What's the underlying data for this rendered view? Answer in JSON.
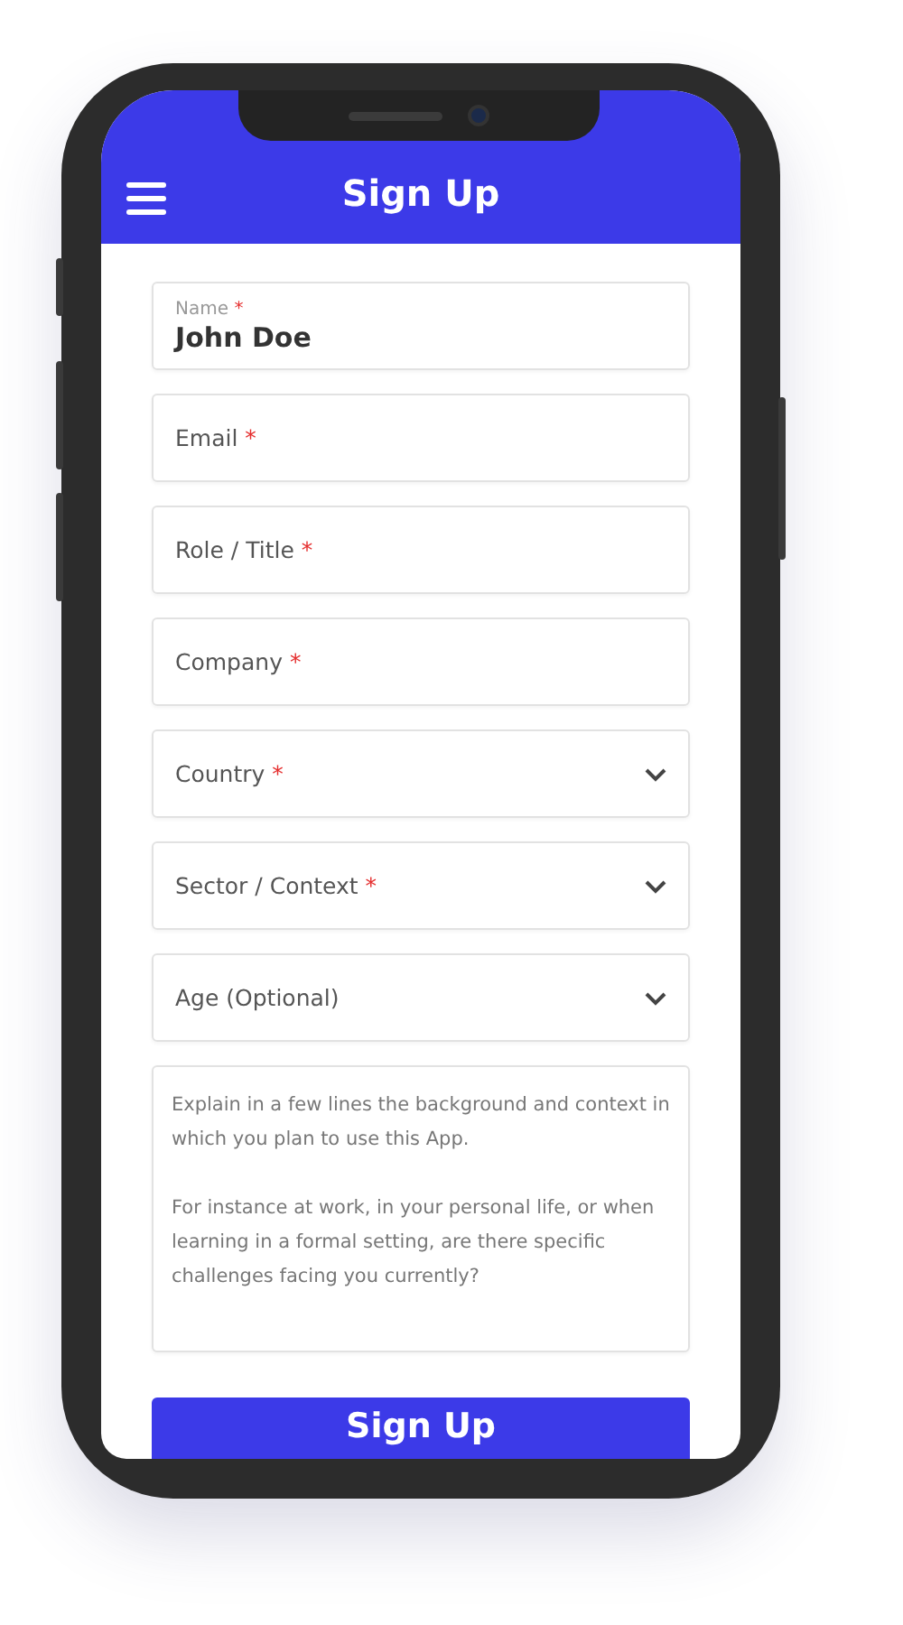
{
  "header": {
    "title": "Sign Up"
  },
  "fields": [
    {
      "kind": "text",
      "label": "Name",
      "required_mark": "*",
      "value": "John Doe"
    },
    {
      "kind": "text",
      "label": "Email",
      "required_mark": "*"
    },
    {
      "kind": "text",
      "label": "Role / Title",
      "required_mark": "*"
    },
    {
      "kind": "text",
      "label": "Company",
      "required_mark": "*"
    },
    {
      "kind": "select",
      "label": "Country",
      "required_mark": "*"
    },
    {
      "kind": "select",
      "label": "Sector / Context",
      "required_mark": "*"
    },
    {
      "kind": "select",
      "label": "Age (Optional)"
    }
  ],
  "description": {
    "placeholder": "Explain in a few lines the background and context in which you plan to use this App.\n\nFor instance at work, in your personal life, or when learning in a formal setting, are there specific challenges facing you currently?"
  },
  "submit_button": "Sign Up"
}
